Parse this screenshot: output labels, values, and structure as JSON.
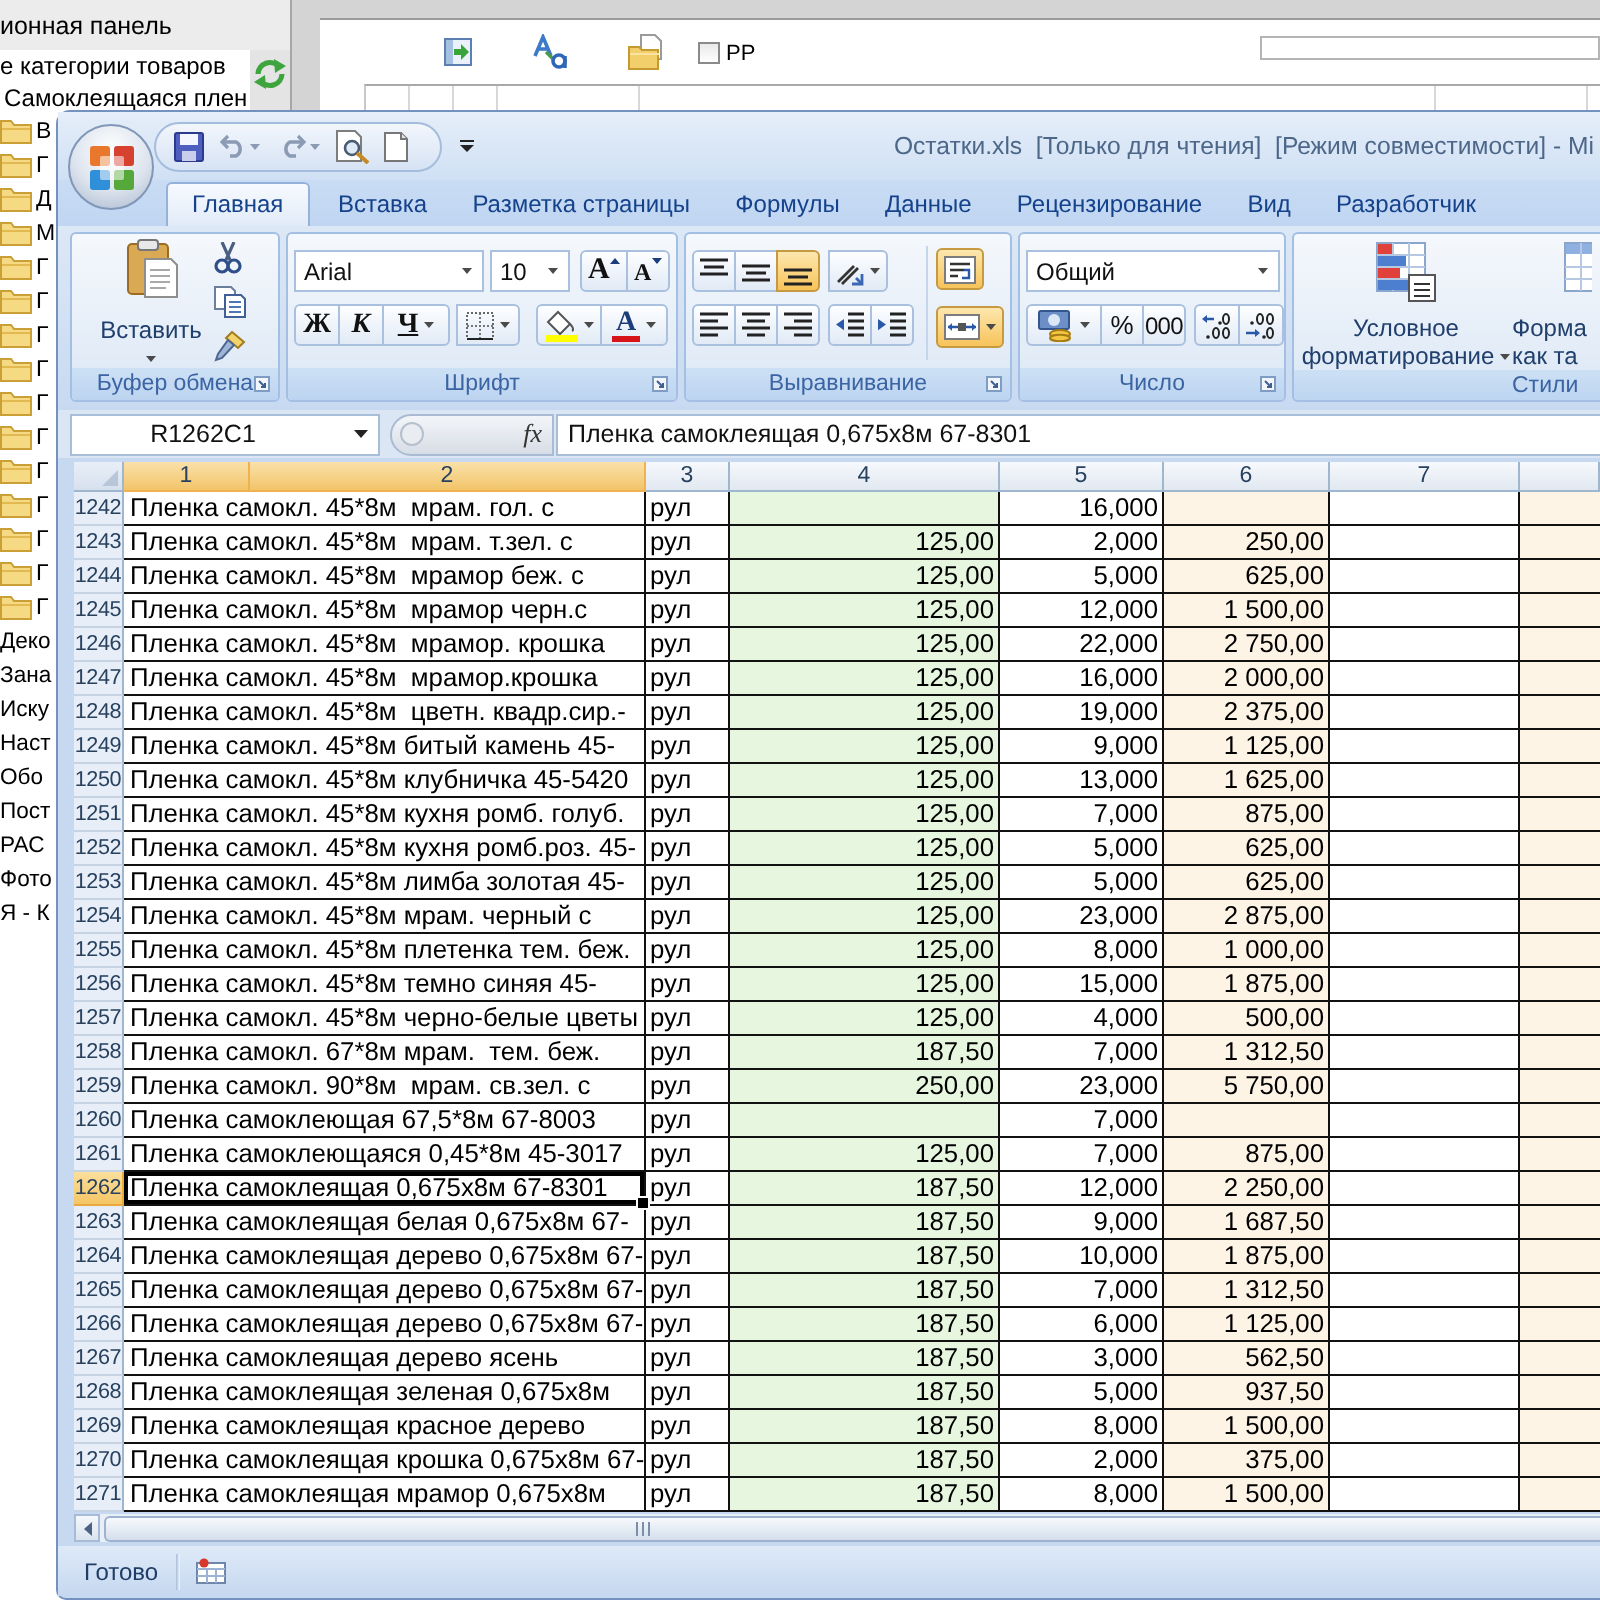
{
  "background_window": {
    "panel_title": "ионная панель",
    "tree_items": [
      {
        "label": "е категории товаров",
        "kind": "plain"
      },
      {
        "label": "Самоклеящаяся плен",
        "kind": "plain"
      },
      {
        "label": "В",
        "kind": "folder"
      },
      {
        "label": "Г",
        "kind": "folder"
      },
      {
        "label": "Д",
        "kind": "folder"
      },
      {
        "label": "М",
        "kind": "folder"
      },
      {
        "label": "Г",
        "kind": "folder"
      },
      {
        "label": "Г",
        "kind": "folder"
      },
      {
        "label": "Г",
        "kind": "folder"
      },
      {
        "label": "Г",
        "kind": "folder"
      },
      {
        "label": "Г",
        "kind": "folder"
      },
      {
        "label": "Г",
        "kind": "folder"
      },
      {
        "label": "Г",
        "kind": "folder"
      },
      {
        "label": "Г",
        "kind": "folder"
      },
      {
        "label": "Г",
        "kind": "folder"
      },
      {
        "label": "Г",
        "kind": "folder"
      },
      {
        "label": "Г",
        "kind": "folder"
      },
      {
        "label": "Деко",
        "kind": "short"
      },
      {
        "label": "Зана",
        "kind": "short"
      },
      {
        "label": "Иску",
        "kind": "short"
      },
      {
        "label": "Наст",
        "kind": "short"
      },
      {
        "label": "Обо",
        "kind": "short"
      },
      {
        "label": "Пост",
        "kind": "short"
      },
      {
        "label": "РАС",
        "kind": "short"
      },
      {
        "label": "Фото",
        "kind": "short"
      },
      {
        "label": "Я - К",
        "kind": "short"
      }
    ],
    "checkbox": {
      "label": "РР",
      "checked": false
    }
  },
  "excel_window": {
    "title": "Остатки.xls  [Только для чтения]  [Режим совместимости] - Mi",
    "tabs": [
      {
        "label": "Главная",
        "selected": true
      },
      {
        "label": "Вставка",
        "selected": false
      },
      {
        "label": "Разметка страницы",
        "selected": false
      },
      {
        "label": "Формулы",
        "selected": false
      },
      {
        "label": "Данные",
        "selected": false
      },
      {
        "label": "Рецензирование",
        "selected": false
      },
      {
        "label": "Вид",
        "selected": false
      },
      {
        "label": "Разработчик",
        "selected": false
      }
    ],
    "ribbon": {
      "clipboard": {
        "label": "Буфер обмена",
        "paste": "Вставить"
      },
      "font": {
        "label": "Шрифт",
        "font_name": "Arial",
        "font_size": "10",
        "grow": "A",
        "shrink": "A",
        "bold": "Ж",
        "italic": "К",
        "underline": "Ч",
        "font_color": "A"
      },
      "alignment": {
        "label": "Выравнивание",
        "buttons": [
          {
            "kind": "top",
            "on": false
          },
          {
            "kind": "middle",
            "on": false
          },
          {
            "kind": "bottom",
            "on": true
          },
          {
            "kind": "orientation",
            "on": false
          },
          {
            "kind": "left",
            "on": false
          },
          {
            "kind": "center",
            "on": false
          },
          {
            "kind": "right",
            "on": false
          },
          {
            "kind": "outdent",
            "on": false
          },
          {
            "kind": "indent",
            "on": false
          },
          {
            "kind": "wrap",
            "on": true
          },
          {
            "kind": "merge",
            "on": true
          }
        ]
      },
      "number": {
        "label": "Число",
        "format": "Общий",
        "percent": "%",
        "thousands": "000"
      },
      "styles": {
        "label": "Стили",
        "conditional": "Условное форматирование",
        "format_table": "Форма как та"
      }
    },
    "name_box": "R1262C1",
    "function_button": "fx",
    "formula": "Пленка самоклеящая 0,675x8м 67-8301",
    "columns": [
      {
        "label": "1",
        "selected": true
      },
      {
        "label": "2",
        "selected": true
      },
      {
        "label": "3",
        "selected": false
      },
      {
        "label": "4",
        "selected": false
      },
      {
        "label": "5",
        "selected": false
      },
      {
        "label": "6",
        "selected": false
      },
      {
        "label": "7",
        "selected": false
      }
    ],
    "rows": [
      {
        "number": "1242",
        "selected": false,
        "column_1": "Пленка самокл. 45*8м  мрам. гол. с",
        "column_3": "рул",
        "column_5": "16,000"
      },
      {
        "number": "1243",
        "selected": false,
        "column_1": "Пленка самокл. 45*8м  мрам. т.зел. с",
        "column_3": "рул",
        "column_4": "125,00",
        "column_5": "2,000",
        "column_6": "250,00"
      },
      {
        "number": "1244",
        "selected": false,
        "column_1": "Пленка самокл. 45*8м  мрамор беж. с",
        "column_3": "рул",
        "column_4": "125,00",
        "column_5": "5,000",
        "column_6": "625,00"
      },
      {
        "number": "1245",
        "selected": false,
        "column_1": "Пленка самокл. 45*8м  мрамор черн.с",
        "column_3": "рул",
        "column_4": "125,00",
        "column_5": "12,000",
        "column_6": "1 500,00"
      },
      {
        "number": "1246",
        "selected": false,
        "column_1": "Пленка самокл. 45*8м  мрамор. крошка",
        "column_3": "рул",
        "column_4": "125,00",
        "column_5": "22,000",
        "column_6": "2 750,00"
      },
      {
        "number": "1247",
        "selected": false,
        "column_1": "Пленка самокл. 45*8м  мрамор.крошка",
        "column_3": "рул",
        "column_4": "125,00",
        "column_5": "16,000",
        "column_6": "2 000,00"
      },
      {
        "number": "1248",
        "selected": false,
        "column_1": "Пленка самокл. 45*8м  цветн. квадр.сир.-",
        "column_3": "рул",
        "column_4": "125,00",
        "column_5": "19,000",
        "column_6": "2 375,00"
      },
      {
        "number": "1249",
        "selected": false,
        "column_1": "Пленка самокл. 45*8м битый камень 45-",
        "column_3": "рул",
        "column_4": "125,00",
        "column_5": "9,000",
        "column_6": "1 125,00"
      },
      {
        "number": "1250",
        "selected": false,
        "column_1": "Пленка самокл. 45*8м клубничка 45-5420",
        "column_3": "рул",
        "column_4": "125,00",
        "column_5": "13,000",
        "column_6": "1 625,00"
      },
      {
        "number": "1251",
        "selected": false,
        "column_1": "Пленка самокл. 45*8м кухня ромб. голуб.",
        "column_3": "рул",
        "column_4": "125,00",
        "column_5": "7,000",
        "column_6": "875,00"
      },
      {
        "number": "1252",
        "selected": false,
        "column_1": "Пленка самокл. 45*8м кухня ромб.роз. 45-",
        "column_3": "рул",
        "column_4": "125,00",
        "column_5": "5,000",
        "column_6": "625,00"
      },
      {
        "number": "1253",
        "selected": false,
        "column_1": "Пленка самокл. 45*8м лимба золотая 45-",
        "column_3": "рул",
        "column_4": "125,00",
        "column_5": "5,000",
        "column_6": "625,00"
      },
      {
        "number": "1254",
        "selected": false,
        "column_1": "Пленка самокл. 45*8м мрам. черный с",
        "column_3": "рул",
        "column_4": "125,00",
        "column_5": "23,000",
        "column_6": "2 875,00"
      },
      {
        "number": "1255",
        "selected": false,
        "column_1": "Пленка самокл. 45*8м плетенка тем. беж.",
        "column_3": "рул",
        "column_4": "125,00",
        "column_5": "8,000",
        "column_6": "1 000,00"
      },
      {
        "number": "1256",
        "selected": false,
        "column_1": "Пленка самокл. 45*8м темно синяя 45-",
        "column_3": "рул",
        "column_4": "125,00",
        "column_5": "15,000",
        "column_6": "1 875,00"
      },
      {
        "number": "1257",
        "selected": false,
        "column_1": "Пленка самокл. 45*8м черно-белые цветы",
        "column_3": "рул",
        "column_4": "125,00",
        "column_5": "4,000",
        "column_6": "500,00"
      },
      {
        "number": "1258",
        "selected": false,
        "column_1": "Пленка самокл. 67*8м мрам.  тем. беж.",
        "column_3": "рул",
        "column_4": "187,50",
        "column_5": "7,000",
        "column_6": "1 312,50"
      },
      {
        "number": "1259",
        "selected": false,
        "column_1": "Пленка самокл. 90*8м  мрам. св.зел. с",
        "column_3": "рул",
        "column_4": "250,00",
        "column_5": "23,000",
        "column_6": "5 750,00"
      },
      {
        "number": "1260",
        "selected": false,
        "column_1": "Пленка самоклеющая 67,5*8м 67-8003",
        "column_3": "рул",
        "column_5": "7,000"
      },
      {
        "number": "1261",
        "selected": false,
        "column_1": "Пленка самоклеющаяся 0,45*8м 45-3017",
        "column_3": "рул",
        "column_4": "125,00",
        "column_5": "7,000",
        "column_6": "875,00"
      },
      {
        "number": "1262",
        "selected": true,
        "column_1": "Пленка самоклеящая 0,675x8м 67-8301",
        "column_3": "рул",
        "column_4": "187,50",
        "column_5": "12,000",
        "column_6": "2 250,00"
      },
      {
        "number": "1263",
        "selected": false,
        "column_1": "Пленка самоклеящая белая 0,675x8м 67-",
        "column_3": "рул",
        "column_4": "187,50",
        "column_5": "9,000",
        "column_6": "1 687,50"
      },
      {
        "number": "1264",
        "selected": false,
        "column_1": "Пленка самоклеящая дерево 0,675x8м 67-",
        "column_3": "рул",
        "column_4": "187,50",
        "column_5": "10,000",
        "column_6": "1 875,00"
      },
      {
        "number": "1265",
        "selected": false,
        "column_1": "Пленка самоклеящая дерево 0,675x8м 67-",
        "column_3": "рул",
        "column_4": "187,50",
        "column_5": "7,000",
        "column_6": "1 312,50"
      },
      {
        "number": "1266",
        "selected": false,
        "column_1": "Пленка самоклеящая дерево 0,675x8м 67-",
        "column_3": "рул",
        "column_4": "187,50",
        "column_5": "6,000",
        "column_6": "1 125,00"
      },
      {
        "number": "1267",
        "selected": false,
        "column_1": "Пленка самоклеящая дерево ясень",
        "column_3": "рул",
        "column_4": "187,50",
        "column_5": "3,000",
        "column_6": "562,50"
      },
      {
        "number": "1268",
        "selected": false,
        "column_1": "Пленка самоклеящая зеленая 0,675x8м",
        "column_3": "рул",
        "column_4": "187,50",
        "column_5": "5,000",
        "column_6": "937,50"
      },
      {
        "number": "1269",
        "selected": false,
        "column_1": "Пленка самоклеящая красное дерево",
        "column_3": "рул",
        "column_4": "187,50",
        "column_5": "8,000",
        "column_6": "1 500,00"
      },
      {
        "number": "1270",
        "selected": false,
        "column_1": "Пленка самоклеящая крошка 0,675x8м 67-",
        "column_3": "рул",
        "column_4": "187,50",
        "column_5": "2,000",
        "column_6": "375,00"
      },
      {
        "number": "1271",
        "selected": false,
        "column_1": "Пленка самоклеящая мрамор 0,675x8м",
        "column_3": "рул",
        "column_4": "187,50",
        "column_5": "8,000",
        "column_6": "1 500,00"
      }
    ],
    "status": "Готово"
  }
}
